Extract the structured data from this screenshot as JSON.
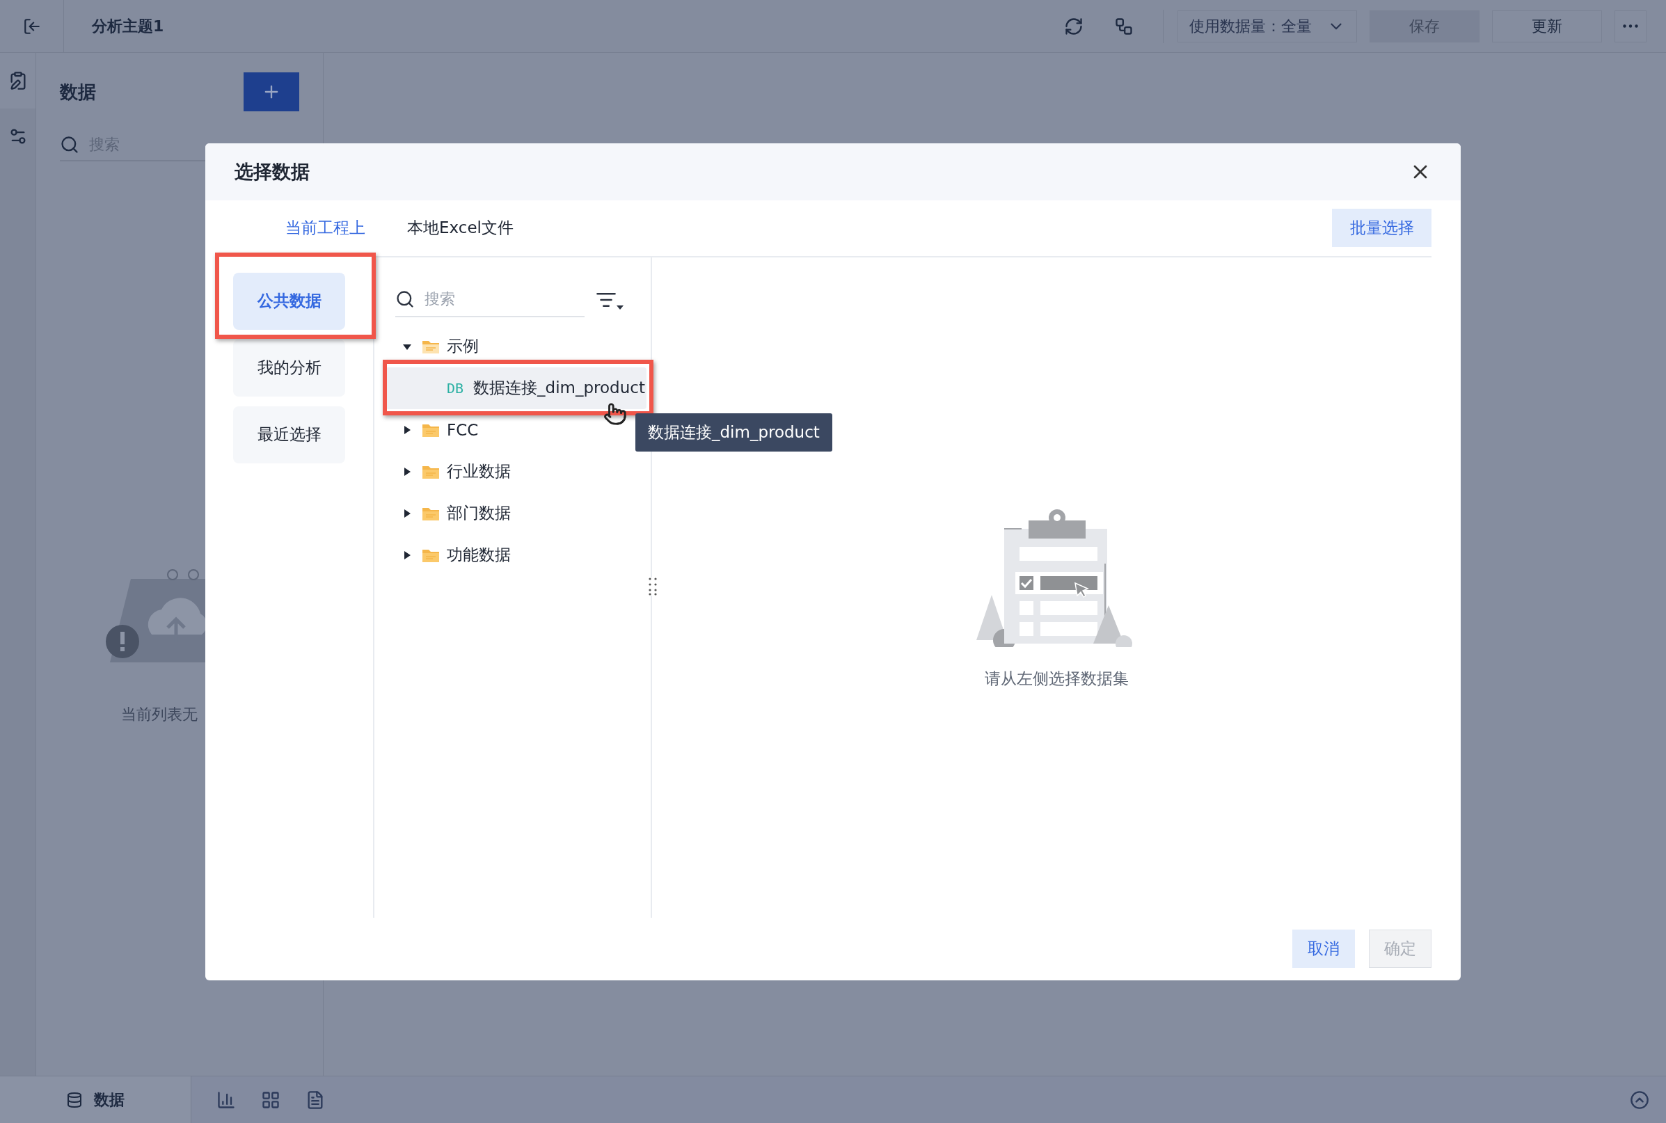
{
  "topbar": {
    "title": "分析主题1",
    "data_amount": "使用数据量：全量",
    "buttons": [
      {
        "label": "保存",
        "disabled": true
      },
      {
        "label": "更新",
        "disabled": false
      }
    ]
  },
  "side_panel": {
    "title": "数据",
    "search": {
      "placeholder": "搜索"
    },
    "empty_text": "当前列表无"
  },
  "bottom_bar": {
    "tab": "数据"
  },
  "dialog": {
    "title": "选择数据",
    "tabs": [
      {
        "label": "当前工程上",
        "selected": true
      },
      {
        "label": "本地Excel文件",
        "selected": false
      }
    ],
    "batch_button": "批量选择",
    "categories": [
      {
        "label": "公共数据",
        "selected": true
      },
      {
        "label": "我的分析",
        "selected": false
      },
      {
        "label": "最近选择",
        "selected": false
      }
    ],
    "tree": {
      "search": {
        "placeholder": "搜索"
      },
      "items": [
        {
          "kind": "folder",
          "label": "示例",
          "expanded": true,
          "children": [
            {
              "kind": "db",
              "badge": "DB",
              "label": "数据连接_dim_product",
              "hovered": true
            }
          ]
        },
        {
          "kind": "folder",
          "label": "FCC",
          "expanded": false
        },
        {
          "kind": "folder",
          "label": "行业数据",
          "expanded": false
        },
        {
          "kind": "folder",
          "label": "部门数据",
          "expanded": false
        },
        {
          "kind": "folder",
          "label": "功能数据",
          "expanded": false
        }
      ]
    },
    "tooltip": "数据连接_dim_product",
    "empty_hint": "请从左侧选择数据集",
    "buttons": [
      {
        "kind": "cancel",
        "label": "取消",
        "disabled": false
      },
      {
        "kind": "confirm",
        "label": "确定",
        "disabled": true
      }
    ]
  }
}
